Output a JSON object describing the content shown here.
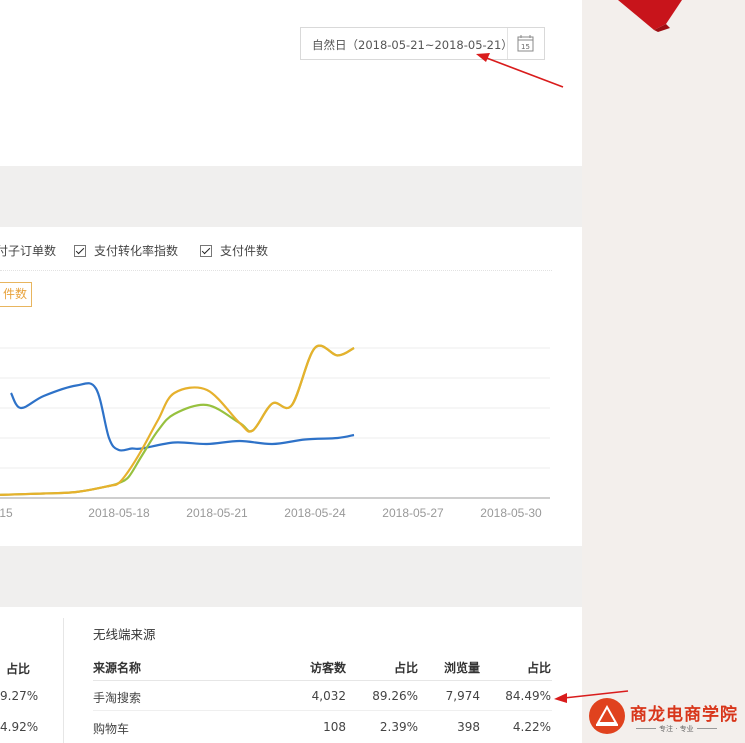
{
  "date_picker": {
    "label": "自然日（2018-05-21~2018-05-21）",
    "calendar_day": "15"
  },
  "legend": [
    {
      "label": "付子订单数",
      "checked": true
    },
    {
      "label": "支付转化率指数",
      "checked": true
    },
    {
      "label": "支付件数",
      "checked": true
    }
  ],
  "metric_tag": "件数",
  "chart_data": {
    "type": "line",
    "x_ticks": [
      "15",
      "2018-05-18",
      "2018-05-21",
      "2018-05-24",
      "2018-05-27",
      "2018-05-30"
    ],
    "series": [
      {
        "color": "#2e72c8",
        "values": [
          [
            0,
            70
          ],
          [
            0.3,
            60
          ],
          [
            1,
            68
          ],
          [
            2,
            75
          ],
          [
            2.6,
            73
          ],
          [
            3,
            40
          ],
          [
            3.3,
            32
          ],
          [
            3.7,
            33
          ],
          [
            4,
            33
          ],
          [
            5,
            37
          ],
          [
            6,
            36
          ],
          [
            7,
            38
          ],
          [
            8,
            36
          ],
          [
            9,
            39
          ],
          [
            10,
            40
          ],
          [
            10.5,
            42
          ]
        ]
      },
      {
        "color": "#97c13f",
        "values": [
          [
            -0.5,
            2
          ],
          [
            1,
            3
          ],
          [
            2,
            4
          ],
          [
            3,
            8
          ],
          [
            3.3,
            10
          ],
          [
            3.6,
            14
          ],
          [
            4,
            28
          ],
          [
            4.5,
            45
          ],
          [
            5,
            56
          ],
          [
            6,
            62
          ],
          [
            7,
            50
          ],
          [
            7.4,
            45
          ],
          [
            8,
            63
          ],
          [
            8.6,
            62
          ],
          [
            9.3,
            100
          ],
          [
            10,
            95
          ],
          [
            10.5,
            100
          ]
        ]
      },
      {
        "color": "#e6b12d",
        "values": [
          [
            -0.5,
            2
          ],
          [
            1,
            3
          ],
          [
            2,
            4
          ],
          [
            3,
            8
          ],
          [
            3.3,
            10
          ],
          [
            3.6,
            18
          ],
          [
            4,
            32
          ],
          [
            4.5,
            52
          ],
          [
            5,
            70
          ],
          [
            6,
            72
          ],
          [
            7,
            50
          ],
          [
            7.4,
            45
          ],
          [
            8,
            63
          ],
          [
            8.6,
            62
          ],
          [
            9.3,
            100
          ],
          [
            10,
            95
          ],
          [
            10.5,
            100
          ]
        ]
      }
    ],
    "grid": true
  },
  "table": {
    "title": "无线端来源",
    "left_header": "占比",
    "left_values": [
      "9.27%",
      "4.92%"
    ],
    "headers": [
      "来源名称",
      "访客数",
      "占比",
      "浏览量",
      "占比"
    ],
    "rows": [
      [
        "手淘搜索",
        "4,032",
        "89.26%",
        "7,974",
        "84.49%"
      ],
      [
        "购物车",
        "108",
        "2.39%",
        "398",
        "4.22%"
      ]
    ]
  },
  "logo": {
    "name": "商龙电商学院",
    "tagline": "专注 · 专业"
  },
  "colors": {
    "arrow": "#d91c1c",
    "ribbon": "#c8141b"
  }
}
